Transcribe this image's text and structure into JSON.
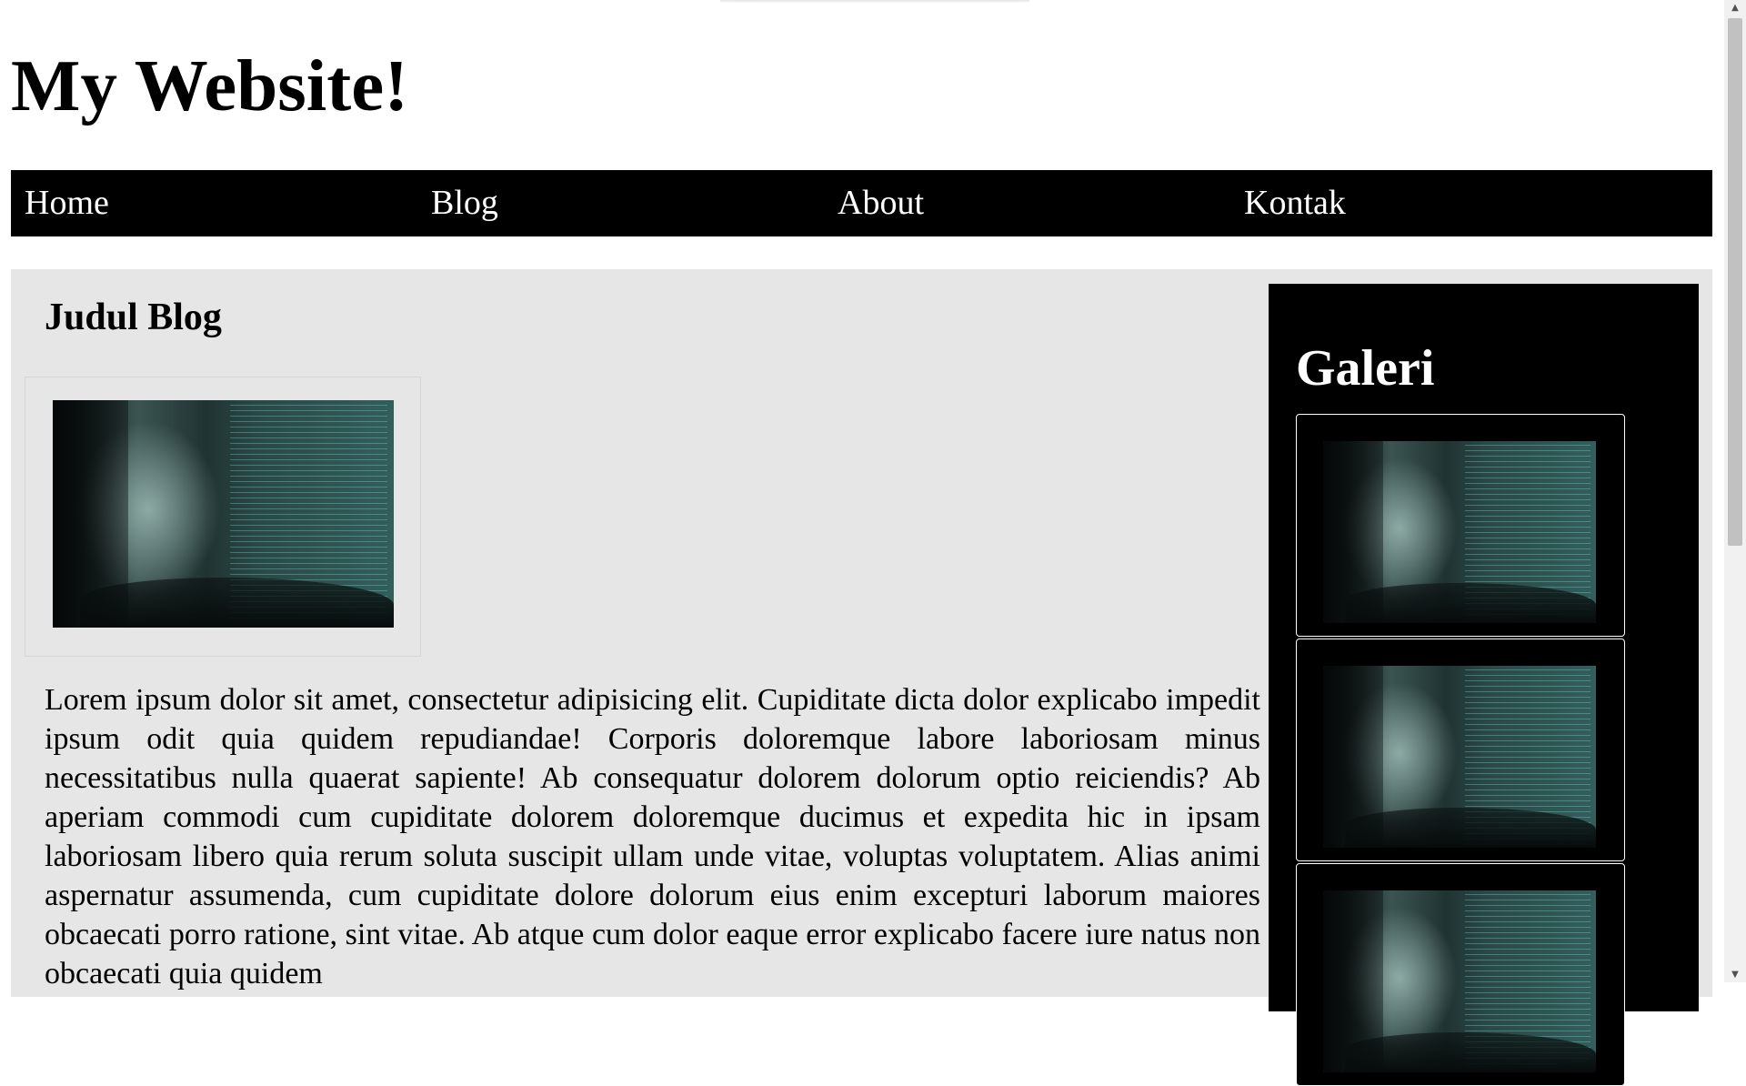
{
  "site": {
    "title": "My Website!"
  },
  "nav": {
    "items": [
      {
        "label": "Home"
      },
      {
        "label": "Blog"
      },
      {
        "label": "About"
      },
      {
        "label": "Kontak"
      }
    ]
  },
  "article": {
    "heading": "Judul Blog",
    "body": "Lorem ipsum dolor sit amet, consectetur adipisicing elit. Cupiditate dicta dolor explicabo impedit ipsum odit quia quidem repudiandae! Corporis doloremque labore laboriosam minus necessitatibus nulla quaerat sapiente! Ab consequatur dolorem dolorum optio reiciendis? Ab aperiam commodi cum cupiditate dolorem doloremque ducimus et expedita hic in ipsam laboriosam libero quia rerum soluta suscipit ullam unde vitae, voluptas voluptatem. Alias animi aspernatur assumenda, cum cupiditate dolore dolorum eius enim excepturi laborum maiores obcaecati porro ratione, sint vitae. Ab atque cum dolor eaque error explicabo facere iure natus non obcaecati quia quidem"
  },
  "sidebar": {
    "heading": "Galeri"
  },
  "colors": {
    "nav_bg": "#000000",
    "content_bg": "#e6e6e6",
    "sidebar_bg": "#000000"
  }
}
